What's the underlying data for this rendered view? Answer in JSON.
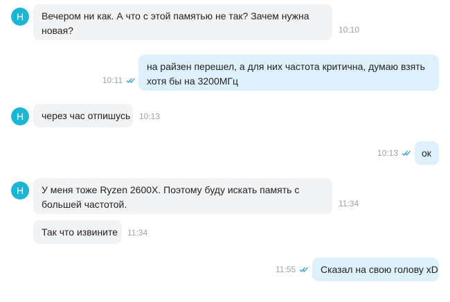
{
  "contact": {
    "initial": "Н"
  },
  "colors": {
    "avatar": "#1ab7d4",
    "incoming": "#f2f3f5",
    "outgoing": "#ddf0fb",
    "read_check": "#2a9cd6",
    "time": "#9aa3ad"
  },
  "messages": [
    {
      "direction": "in",
      "text_1": "Вечером ни как. А что с этой памятью не так? Зачем нужна",
      "text_2": "новая?",
      "time": "10:10"
    },
    {
      "direction": "out",
      "text_1": "на райзен перешел, а для них частота критична, думаю взять",
      "text_2": "хотя бы на 3200МГц",
      "time": "10:11",
      "status_icon": "double-check-icon"
    },
    {
      "direction": "in",
      "text_1": "через час отпишусь",
      "time": "10:13"
    },
    {
      "direction": "out",
      "text_1": "ок",
      "time": "10:13",
      "status_icon": "double-check-icon"
    },
    {
      "direction": "in",
      "text_1": "У меня тоже Ryzen 2600X. Поэтому буду искать память с",
      "text_2": "большей частотой.",
      "time": "11:34"
    },
    {
      "direction": "in",
      "text_1": "Так что извините",
      "time": "11:34"
    },
    {
      "direction": "out",
      "text_1": "Сказал на свою голову xD",
      "time": "11:55",
      "status_icon": "double-check-icon"
    }
  ]
}
